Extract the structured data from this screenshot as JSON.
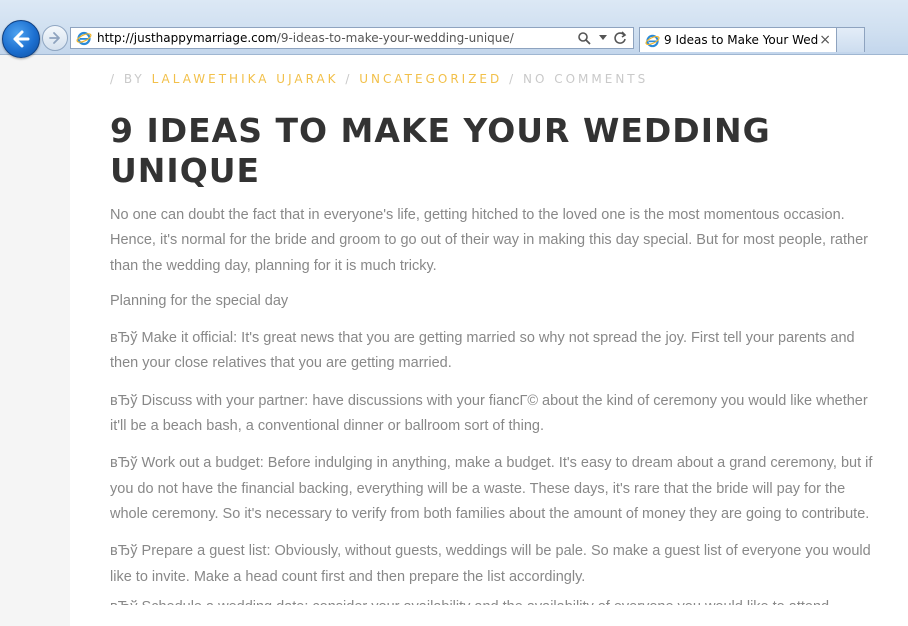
{
  "browser": {
    "url_host": "http://justhappymarriage.com",
    "url_path": "/9-ideas-to-make-your-wedding-unique/",
    "tab_title": "9 Ideas to Make Your Wedd...",
    "tab_close": "×",
    "accent_color": "#1c6fd0"
  },
  "post": {
    "meta": {
      "by_prefix": "/ BY",
      "author": "LALAWETHIKA UJARAK",
      "sep1": "/",
      "category": "UNCATEGORIZED",
      "sep2": "/",
      "comments": "NO COMMENTS"
    },
    "title": "9 IDEAS TO MAKE YOUR WEDDING UNIQUE",
    "paragraphs": [
      "No one can doubt the fact that in everyone's life, getting hitched to the loved one is the most momentous occasion. Hence, it's normal for the bride and groom to go out of their way in making this day special. But for most people, rather than the wedding day, planning for it is much tricky.",
      "Planning for the special day",
      "вЂў Make it official: It's great news that you are getting married so why not spread the joy. First tell your parents and then your close relatives that you are getting married.",
      "вЂў Discuss with your partner: have discussions with your fiancГ© about the kind of ceremony you would like whether it'll be a beach bash, a conventional dinner or ballroom sort of thing.",
      "вЂў Work out a budget: Before indulging in anything, make a budget. It's easy to dream about a grand ceremony, but if you do not have the financial backing, everything will be a waste. These days, it's rare that the bride will pay for the whole ceremony. So it's necessary to verify from both families about the amount of money they are going to contribute.",
      "вЂў Prepare a guest list: Obviously, without guests, weddings will be pale. So make a guest list of everyone you would like to invite. Make a head count first and then prepare the list accordingly."
    ],
    "clipped_line": "вЂў Schedule a wedding date: consider your availability and the availability of everyone you would like to attend"
  }
}
